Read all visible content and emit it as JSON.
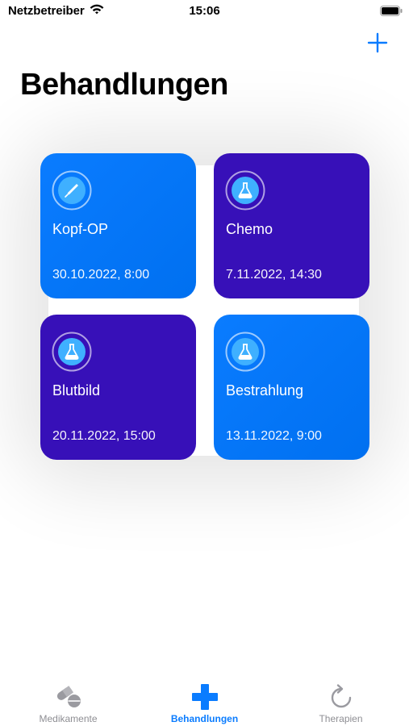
{
  "status_bar": {
    "carrier": "Netzbetreiber",
    "time": "15:06"
  },
  "header": {
    "title": "Behandlungen",
    "add_icon": "plus-icon"
  },
  "colors": {
    "accent": "#0a7cff",
    "card_blue": "#0a7cff",
    "card_purple": "#3710b8",
    "tab_inactive": "#8e8e93"
  },
  "treatments": [
    {
      "title": "Kopf-OP",
      "date": "30.10.2022, 8:00",
      "icon": "scalpel-icon",
      "color": "blue"
    },
    {
      "title": "Chemo",
      "date": "7.11.2022, 14:30",
      "icon": "flask-icon",
      "color": "purple"
    },
    {
      "title": "Blutbild",
      "date": "20.11.2022, 15:00",
      "icon": "flask-icon",
      "color": "purple"
    },
    {
      "title": "Bestrahlung",
      "date": "13.11.2022, 9:00",
      "icon": "flask-icon",
      "color": "blue"
    }
  ],
  "tab_bar": {
    "tabs": [
      {
        "label": "Medikamente",
        "icon": "pills-icon",
        "active": false
      },
      {
        "label": "Behandlungen",
        "icon": "medical-cross-icon",
        "active": true
      },
      {
        "label": "Therapien",
        "icon": "refresh-icon",
        "active": false
      }
    ]
  }
}
